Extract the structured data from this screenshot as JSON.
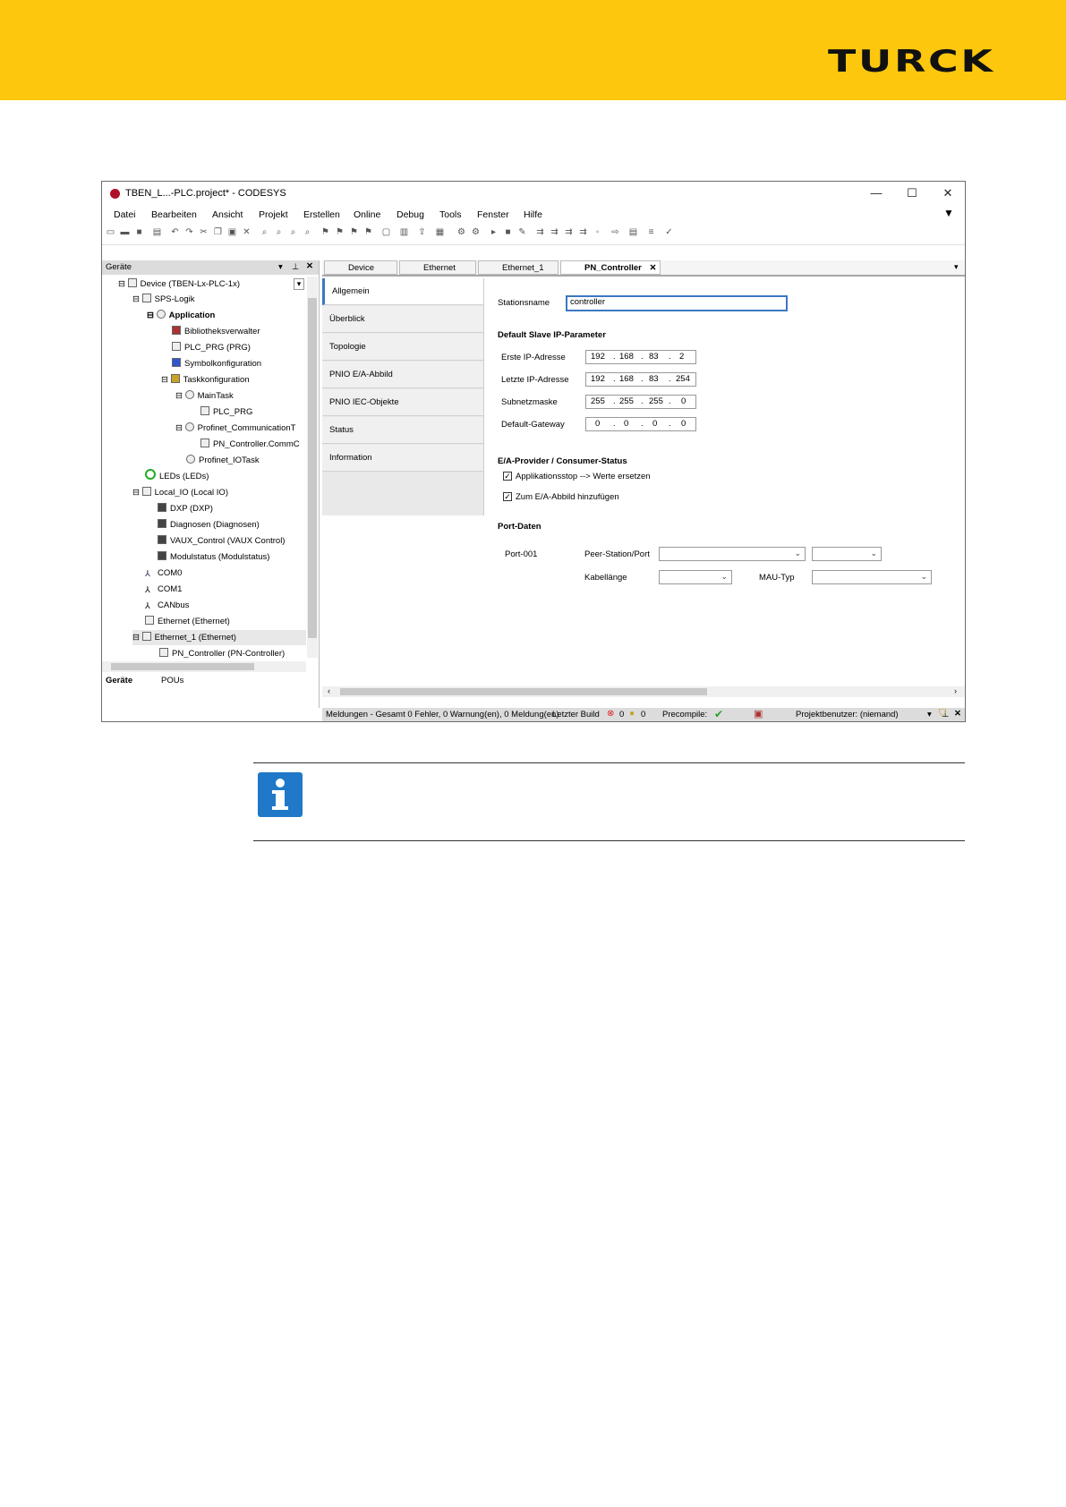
{
  "brand": {
    "logo_text": "TURCK",
    "banner_color": "#fcc70d"
  },
  "window": {
    "title": "TBEN_L...-PLC.project* - CODESYS",
    "controls": {
      "minimize": "—",
      "maximize": "☐",
      "close": "✕"
    }
  },
  "menu": [
    "Datei",
    "Bearbeiten",
    "Ansicht",
    "Projekt",
    "Erstellen",
    "Online",
    "Debug",
    "Tools",
    "Fenster",
    "Hilfe"
  ],
  "left_pane": {
    "title": "Geräte",
    "tree": [
      {
        "label": "Device (TBEN-Lx-PLC-1x)",
        "icon": "device-icon",
        "expander": "⊟"
      },
      {
        "label": "SPS-Logik",
        "icon": "plc-logic-icon",
        "expander": "⊟"
      },
      {
        "label": "Application",
        "icon": "application-icon",
        "expander": "⊟"
      },
      {
        "label": "Bibliotheksverwalter",
        "icon": "library-icon"
      },
      {
        "label": "PLC_PRG (PRG)",
        "icon": "program-icon"
      },
      {
        "label": "Symbolkonfiguration",
        "icon": "symbol-icon"
      },
      {
        "label": "Taskkonfiguration",
        "icon": "task-config-icon",
        "expander": "⊟"
      },
      {
        "label": "MainTask",
        "icon": "task-icon",
        "expander": "⊟"
      },
      {
        "label": "PLC_PRG",
        "icon": "program-icon"
      },
      {
        "label": "Profinet_CommunicationT",
        "icon": "task-icon",
        "expander": "⊟"
      },
      {
        "label": "PN_Controller.CommC",
        "icon": "program-icon"
      },
      {
        "label": "Profinet_IOTask",
        "icon": "task-icon"
      },
      {
        "label": "LEDs (LEDs)",
        "icon": "led-icon"
      },
      {
        "label": "Local_IO (Local IO)",
        "icon": "io-icon",
        "expander": "⊟"
      },
      {
        "label": "DXP (DXP)",
        "icon": "module-icon"
      },
      {
        "label": "Diagnosen (Diagnosen)",
        "icon": "module-icon"
      },
      {
        "label": "VAUX_Control (VAUX Control)",
        "icon": "module-icon"
      },
      {
        "label": "Modulstatus (Modulstatus)",
        "icon": "module-icon"
      },
      {
        "label": "COM0",
        "icon": "com-icon"
      },
      {
        "label": "COM1",
        "icon": "com-icon"
      },
      {
        "label": "CANbus",
        "icon": "com-icon"
      },
      {
        "label": "Ethernet (Ethernet)",
        "icon": "ethernet-icon"
      },
      {
        "label": "Ethernet_1 (Ethernet)",
        "icon": "ethernet-icon",
        "expander": "⊟"
      },
      {
        "label": "PN_Controller (PN-Controller)",
        "icon": "pn-controller-icon"
      }
    ],
    "bottom_tabs": [
      "Geräte",
      "POUs"
    ]
  },
  "editor": {
    "tabs": [
      "Device",
      "Ethernet",
      "Ethernet_1",
      "PN_Controller"
    ],
    "active_tab": "PN_Controller",
    "side_tabs": [
      "Allgemein",
      "Überblick",
      "Topologie",
      "PNIO E/A-Abbild",
      "PNIO IEC-Objekte",
      "Status",
      "Information"
    ],
    "stationsname_label": "Stationsname",
    "stationsname_value": "controller",
    "default_slave_heading": "Default Slave IP-Parameter",
    "ip_rows": [
      {
        "label": "Erste IP-Adresse",
        "octets": [
          "192",
          "168",
          "83",
          "2"
        ]
      },
      {
        "label": "Letzte IP-Adresse",
        "octets": [
          "192",
          "168",
          "83",
          "254"
        ]
      },
      {
        "label": "Subnetzmaske",
        "octets": [
          "255",
          "255",
          "255",
          "0"
        ]
      },
      {
        "label": "Default-Gateway",
        "octets": [
          "0",
          "0",
          "0",
          "0"
        ]
      }
    ],
    "ea_heading": "E/A-Provider / Consumer-Status",
    "checkbox1": "Applikationsstop --> Werte ersetzen",
    "checkbox2": "Zum E/A-Abbild hinzufügen",
    "port_heading": "Port-Daten",
    "port_label": "Port-001",
    "peer_label": "Peer-Station/Port",
    "kabel_label": "Kabellänge",
    "mau_label": "MAU-Typ"
  },
  "messages": {
    "text": "Meldungen - Gesamt 0 Fehler, 0 Warnung(en), 0 Meldung(en)"
  },
  "status": {
    "last_build": "Letzter Build",
    "errors": "0",
    "warnings": "0",
    "precompile": "Precompile:",
    "user": "Projektbenutzer: (niemand)"
  },
  "note": {
    "icon": "info-icon",
    "color": "#1f78c8"
  }
}
